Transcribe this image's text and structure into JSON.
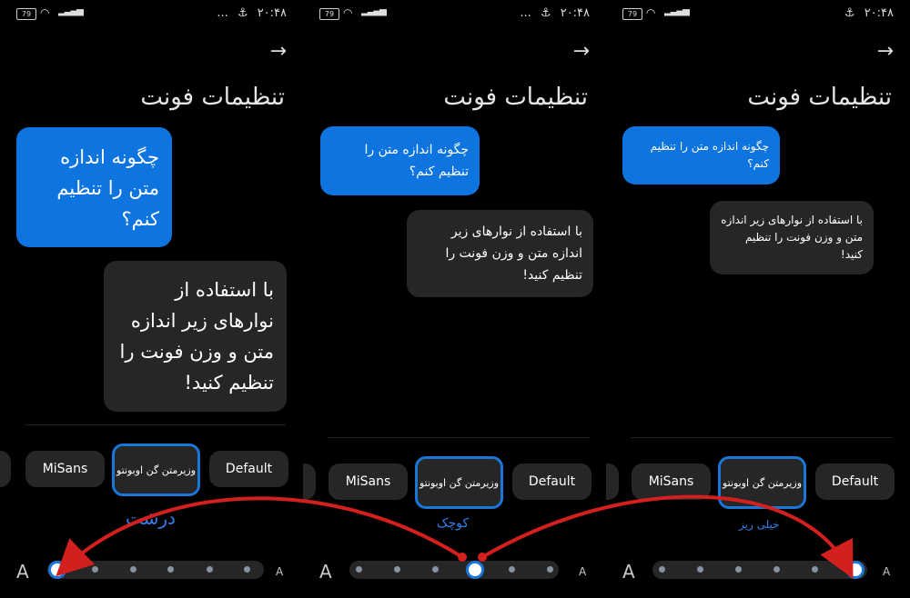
{
  "status_bar": {
    "battery": "79",
    "time": "۲۰:۴۸",
    "more": "..."
  },
  "back_icon": "arrow-right-icon",
  "screen_title": "تنظیمات فونت",
  "panels": [
    {
      "question": "چگونه اندازه متن را تنظیم کنم؟",
      "answer": "با استفاده از نوارهای زیر اندازه متن و وزن فونت را تنظیم کنید!",
      "size_label": "درشت",
      "selected_step": 0
    },
    {
      "question": "چگونه اندازه متن را تنظیم کنم؟",
      "answer": "با استفاده از نوارهای زیر اندازه متن و وزن فونت را تنظیم کنید!",
      "size_label": "کوچک",
      "selected_step": 5
    },
    {
      "question": "چگونه اندازه متن را تنظیم کنم؟",
      "answer": "با استفاده از نوارهای زیر اندازه متن و وزن فونت را تنظیم کنید!",
      "size_label": "خیلی ریز",
      "selected_step": 7
    }
  ],
  "font_options": {
    "misans": "MiSans",
    "vazir": "وزیرمتن گن اوبونتو",
    "default": "Default"
  },
  "slider": {
    "min_label": "A",
    "max_label": "A",
    "steps": 8
  },
  "colors": {
    "accent": "#1a76d8",
    "annotation_arrow": "#d41f1f",
    "bubble_question": "#0d74e0",
    "bubble_answer": "#262626"
  }
}
